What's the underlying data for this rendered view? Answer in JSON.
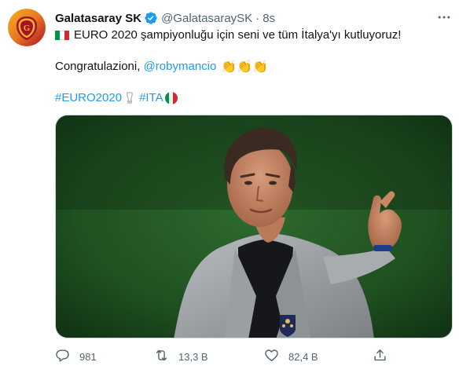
{
  "tweet": {
    "author_name": "Galatasaray SK",
    "handle": "@GalatasaraySK",
    "separator": "·",
    "time": "8s",
    "line1_text": "EURO 2020 şampiyonluğu için seni ve tüm İtalya'yı kutluyoruz!",
    "line2_prefix": "Congratulazioni, ",
    "mention": "@robymancio",
    "claps": "👏👏👏",
    "hashtag1": "#EURO2020",
    "hashtag2": "#ITA"
  },
  "actions": {
    "reply_count": "981",
    "retweet_count": "13,3 B",
    "like_count": "82,4 B"
  },
  "icons": {
    "avatar": "galatasaray-logo",
    "verified": "verified-badge-icon",
    "more": "more-icon",
    "reply": "reply-icon",
    "retweet": "retweet-icon",
    "like": "like-icon",
    "share": "share-icon",
    "trophy": "trophy-icon",
    "flag": "italy-flag-icon"
  },
  "colors": {
    "link": "#1d9bf0",
    "verified": "#1d9bf0",
    "secondary_text": "#536471",
    "primary_text": "#0f1419",
    "brand_red": "#a9102b",
    "brand_yellow": "#f3b323",
    "italy_green": "#009246",
    "italy_red": "#ce2b37"
  }
}
